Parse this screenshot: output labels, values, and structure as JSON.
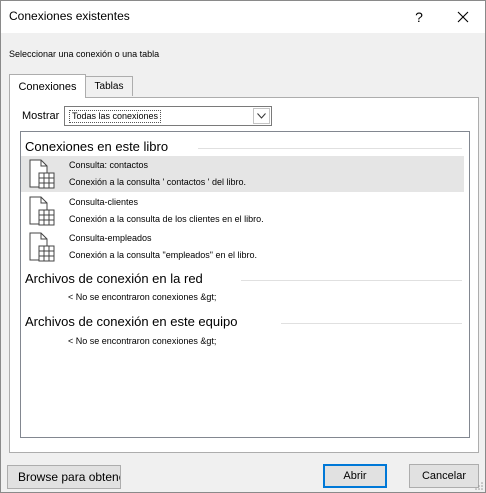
{
  "dialog": {
    "title": "Conexiones existentes",
    "help_glyph": "?",
    "subtitle": "Seleccionar una conexión o una tabla"
  },
  "tabs": [
    {
      "label": "Conexiones",
      "active": true
    },
    {
      "label": "Tablas",
      "active": false
    }
  ],
  "filter": {
    "label": "Mostrar",
    "selected": "Todas las conexiones"
  },
  "groups": {
    "workbook": {
      "title": "Conexiones en este libro",
      "items": [
        {
          "name": "Consulta: contactos",
          "description": "Conexión a la consulta ' contactos ' del libro.",
          "selected": true
        },
        {
          "name": "Consulta-clientes",
          "description": "Conexión a la consulta de los clientes en el libro.",
          "selected": false
        },
        {
          "name": "Consulta-empleados",
          "description": "Conexión a la consulta \"empleados\" en el libro.",
          "selected": false
        }
      ]
    },
    "network": {
      "title": "Archivos de conexión en la red",
      "empty_message": "< No se encontraron conexiones &gt;"
    },
    "computer": {
      "title": "Archivos de conexión en este equipo",
      "empty_message": "< No se encontraron conexiones &gt;"
    }
  },
  "buttons": {
    "browse": "Browse para obtener más información...",
    "open": "Abrir",
    "cancel": "Cancelar"
  },
  "colors": {
    "accent": "#0078d7",
    "selection": "#e5e5e5"
  }
}
